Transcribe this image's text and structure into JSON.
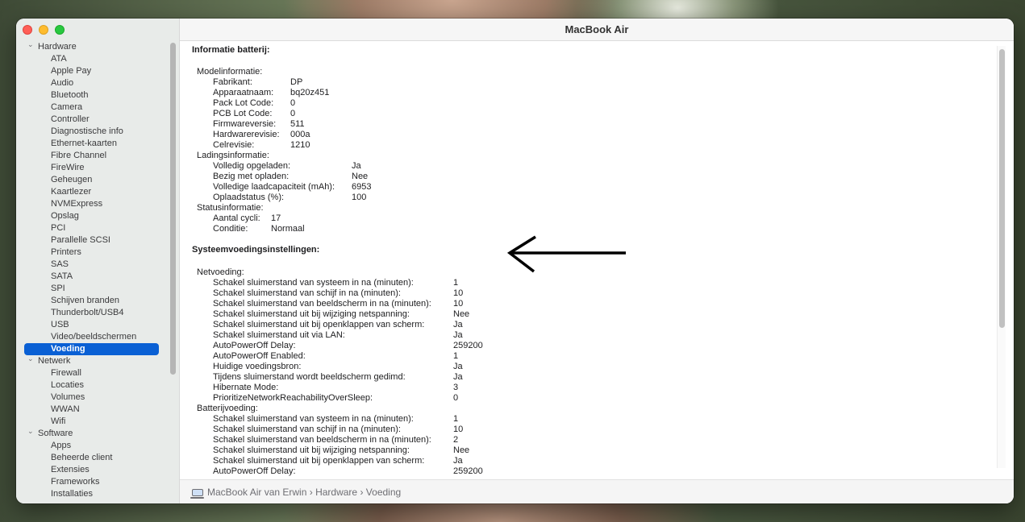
{
  "window": {
    "title": "MacBook Air"
  },
  "sidebar": {
    "groups": [
      {
        "label": "Hardware",
        "items": [
          "ATA",
          "Apple Pay",
          "Audio",
          "Bluetooth",
          "Camera",
          "Controller",
          "Diagnostische info",
          "Ethernet-kaarten",
          "Fibre Channel",
          "FireWire",
          "Geheugen",
          "Kaartlezer",
          "NVMExpress",
          "Opslag",
          "PCI",
          "Parallelle SCSI",
          "Printers",
          "SAS",
          "SATA",
          "SPI",
          "Schijven branden",
          "Thunderbolt/USB4",
          "USB",
          "Video/beeldschermen",
          "Voeding"
        ]
      },
      {
        "label": "Netwerk",
        "items": [
          "Firewall",
          "Locaties",
          "Volumes",
          "WWAN",
          "Wifi"
        ]
      },
      {
        "label": "Software",
        "items": [
          "Apps",
          "Beheerde client",
          "Extensies",
          "Frameworks",
          "Installaties"
        ]
      }
    ],
    "selected": "Voeding"
  },
  "content": {
    "battery_heading": "Informatie batterij:",
    "battery_sections": [
      {
        "label": "Modelinformatie:",
        "rows": [
          [
            "Fabrikant:",
            "DP"
          ],
          [
            "Apparaatnaam:",
            "bq20z451"
          ],
          [
            "Pack Lot Code:",
            "0"
          ],
          [
            "PCB Lot Code:",
            "0"
          ],
          [
            "Firmwareversie:",
            "511"
          ],
          [
            "Hardwarerevisie:",
            "000a"
          ],
          [
            "Celrevisie:",
            "1210"
          ]
        ]
      },
      {
        "label": "Ladingsinformatie:",
        "rows": [
          [
            "Volledig opgeladen:",
            "Ja"
          ],
          [
            "Bezig met opladen:",
            "Nee"
          ],
          [
            "Volledige laadcapaciteit (mAh):",
            "6953"
          ],
          [
            "Oplaadstatus (%):",
            "100"
          ]
        ]
      },
      {
        "label": "Statusinformatie:",
        "rows": [
          [
            "Aantal cycli:",
            "17"
          ],
          [
            "Conditie:",
            "Normaal"
          ]
        ]
      }
    ],
    "power_heading": "Systeemvoedingsinstellingen:",
    "power_sections": [
      {
        "label": "Netvoeding:",
        "rows": [
          [
            "Schakel sluimerstand van systeem in na (minuten):",
            "1"
          ],
          [
            "Schakel sluimerstand van schijf in na (minuten):",
            "10"
          ],
          [
            "Schakel sluimerstand van beeldscherm in na (minuten):",
            "10"
          ],
          [
            "Schakel sluimerstand uit bij wijziging netspanning:",
            "Nee"
          ],
          [
            "Schakel sluimerstand uit bij openklappen van scherm:",
            "Ja"
          ],
          [
            "Schakel sluimerstand uit via LAN:",
            "Ja"
          ],
          [
            "AutoPowerOff Delay:",
            "259200"
          ],
          [
            "AutoPowerOff Enabled:",
            "1"
          ],
          [
            "Huidige voedingsbron:",
            "Ja"
          ],
          [
            "Tijdens sluimerstand wordt beeldscherm gedimd:",
            "Ja"
          ],
          [
            "Hibernate Mode:",
            "3"
          ],
          [
            "PrioritizeNetworkReachabilityOverSleep:",
            "0"
          ]
        ]
      },
      {
        "label": "Batterijvoeding:",
        "rows": [
          [
            "Schakel sluimerstand van systeem in na (minuten):",
            "1"
          ],
          [
            "Schakel sluimerstand van schijf in na (minuten):",
            "10"
          ],
          [
            "Schakel sluimerstand van beeldscherm in na (minuten):",
            "2"
          ],
          [
            "Schakel sluimerstand uit bij wijziging netspanning:",
            "Nee"
          ],
          [
            "Schakel sluimerstand uit bij openklappen van scherm:",
            "Ja"
          ],
          [
            "AutoPowerOff Delay:",
            "259200"
          ]
        ]
      }
    ]
  },
  "statusbar": {
    "computer": "MacBook Air van Erwin",
    "separator": "›",
    "crumbs": [
      "Hardware",
      "Voeding"
    ]
  },
  "icons": {
    "close": "close-icon",
    "minimize": "minimize-icon",
    "zoom": "zoom-icon",
    "laptop": "laptop-icon",
    "annotation": "arrow-left-icon"
  }
}
